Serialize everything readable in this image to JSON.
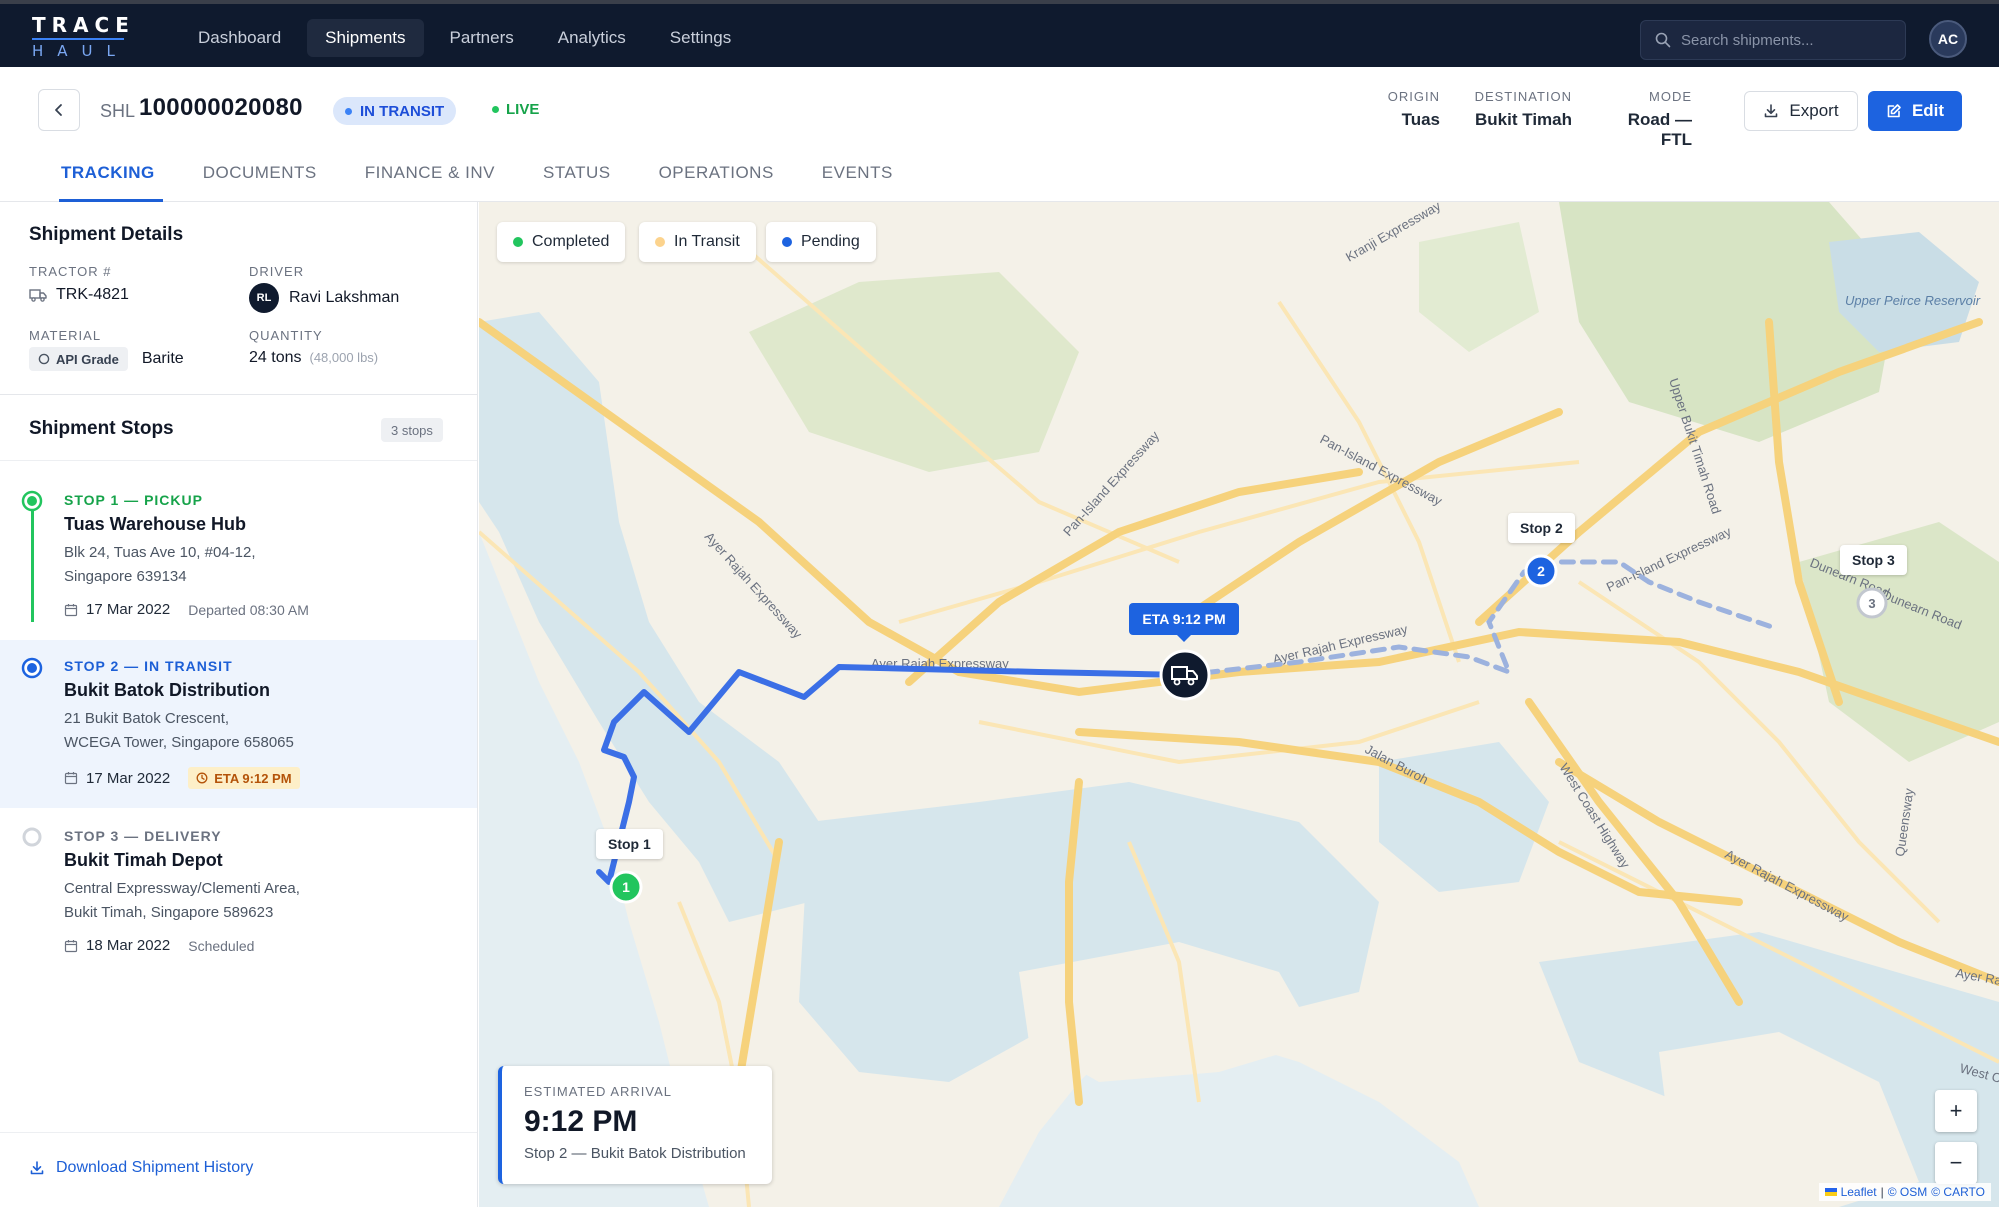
{
  "app": {
    "logo_top": "TRACE",
    "logo_bottom": "HAUL",
    "nav": [
      "Dashboard",
      "Shipments",
      "Partners",
      "Analytics",
      "Settings"
    ],
    "active_nav": "Shipments",
    "search_placeholder": "Search shipments...",
    "user_initials": "AC"
  },
  "shipment": {
    "prefix": "SHL",
    "id": "100000020080",
    "status_badge": "IN TRANSIT",
    "live_label": "LIVE",
    "origin_label": "ORIGIN",
    "origin": "Tuas",
    "destination_label": "DESTINATION",
    "destination": "Bukit Timah",
    "mode_label": "MODE",
    "mode": "Road — FTL",
    "export_label": "Export",
    "edit_label": "Edit"
  },
  "tabs": [
    "TRACKING",
    "DOCUMENTS",
    "FINANCE & INV",
    "STATUS",
    "OPERATIONS",
    "EVENTS"
  ],
  "details": {
    "title": "Shipment Details",
    "tractor_label": "TRACTOR #",
    "tractor": "TRK-4821",
    "driver_label": "DRIVER",
    "driver_initials": "RL",
    "driver": "Ravi Lakshman",
    "material_label": "MATERIAL",
    "material_grade": "API Grade",
    "material": "Barite",
    "quantity_label": "QUANTITY",
    "quantity": "24 tons",
    "quantity_alt": "(48,000 lbs)"
  },
  "stops_section": {
    "title": "Shipment Stops",
    "count": "3 stops",
    "stops": [
      {
        "kicker": "STOP 1 — PICKUP",
        "name": "Tuas Warehouse Hub",
        "addr1": "Blk 24, Tuas Ave 10, #04-12,",
        "addr2": "Singapore 639134",
        "date": "17 Mar 2022",
        "note": "Departed 08:30 AM"
      },
      {
        "kicker": "STOP 2 — IN TRANSIT",
        "name": "Bukit Batok Distribution",
        "addr1": "21 Bukit Batok Crescent,",
        "addr2": "WCEGA Tower, Singapore 658065",
        "date": "17 Mar 2022",
        "note": "ETA 9:12 PM"
      },
      {
        "kicker": "STOP 3 — DELIVERY",
        "name": "Bukit Timah Depot",
        "addr1": "Central Expressway/Clementi Area,",
        "addr2": "Bukit Timah, Singapore 589623",
        "date": "18 Mar 2022",
        "note": "Scheduled"
      }
    ],
    "download_label": "Download Shipment History"
  },
  "map": {
    "legend": [
      "Completed",
      "In Transit",
      "Pending"
    ],
    "colors": {
      "completed": "#22c55e",
      "in_transit": "#fbbf24",
      "pending": "#1d63e0",
      "route": "#3b6fe6"
    },
    "stop_labels": [
      "Stop 1",
      "Stop 2",
      "Stop 3"
    ],
    "stop_numbers": [
      "1",
      "2",
      "3"
    ],
    "eta_bubble": "ETA 9:12 PM",
    "place_names": [
      "Kranji Expressway",
      "Pan-Island Expressway",
      "Pan-Island Expressway",
      "Ayer Rajah Expressway",
      "Ayer Rajah Expressway",
      "Ayer Rajah Expressway",
      "Ayer Rajah Expressway",
      "Upper Bukit Timah Road",
      "Dunearn Road",
      "Dunearn Road",
      "Jalan Buroh",
      "West Coast Highway",
      "Queensway",
      "Upper Peirce Reservoir",
      "Pan-Island Expressway",
      "West Co",
      "Ayer Raj"
    ],
    "eta_card": {
      "label": "ESTIMATED ARRIVAL",
      "time": "9:12 PM",
      "stop": "Stop 2 — Bukit Batok Distribution"
    },
    "zoom_in": "+",
    "zoom_out": "−",
    "attribution": {
      "leaflet": "Leaflet",
      "sep": "|",
      "osm": "© OSM",
      "carto": "© CARTO"
    }
  }
}
